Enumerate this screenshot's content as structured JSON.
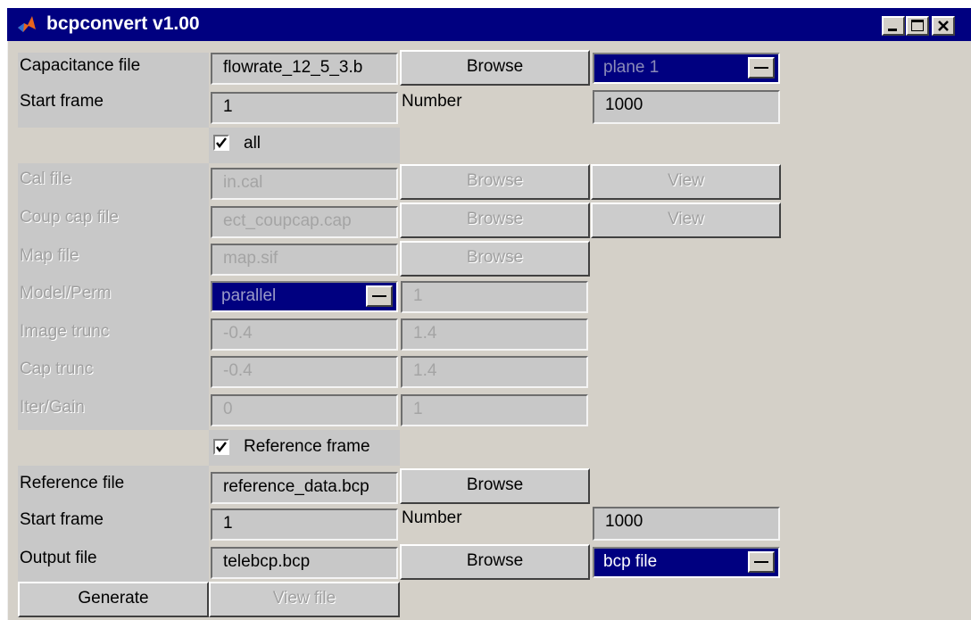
{
  "window": {
    "title": "bcpconvert v1.00"
  },
  "capacitance": {
    "label": "Capacitance file",
    "value": "flowrate_12_5_3.b",
    "browse": "Browse",
    "plane": "plane 1"
  },
  "start1": {
    "label": "Start frame",
    "value": "1",
    "number_label": "Number",
    "number_value": "1000"
  },
  "all": {
    "label": "all",
    "checked": true
  },
  "cal": {
    "label": "Cal file",
    "value": "in.cal",
    "browse": "Browse",
    "view": "View"
  },
  "coup": {
    "label": "Coup cap file",
    "value": "ect_coupcap.cap",
    "browse": "Browse",
    "view": "View"
  },
  "map": {
    "label": "Map file",
    "value": "map.sif",
    "browse": "Browse"
  },
  "model": {
    "label": "Model/Perm",
    "select": "parallel",
    "value": "1"
  },
  "image_trunc": {
    "label": "Image trunc",
    "a": "-0.4",
    "b": "1.4"
  },
  "cap_trunc": {
    "label": "Cap trunc",
    "a": "-0.4",
    "b": "1.4"
  },
  "iter": {
    "label": "Iter/Gain",
    "a": "0",
    "b": "1"
  },
  "ref_frame": {
    "label": "Reference frame",
    "checked": true
  },
  "reference": {
    "label": "Reference file",
    "value": "reference_data.bcp",
    "browse": "Browse"
  },
  "start2": {
    "label": "Start frame",
    "value": "1",
    "number_label": "Number",
    "number_value": "1000"
  },
  "output": {
    "label": "Output file",
    "value": "telebcp.bcp",
    "browse": "Browse",
    "type": "bcp file"
  },
  "actions": {
    "generate": "Generate",
    "view_file": "View file"
  },
  "colors": {
    "titlebar": "#000080",
    "face": "#d4d0c8",
    "selection": "#000080"
  }
}
